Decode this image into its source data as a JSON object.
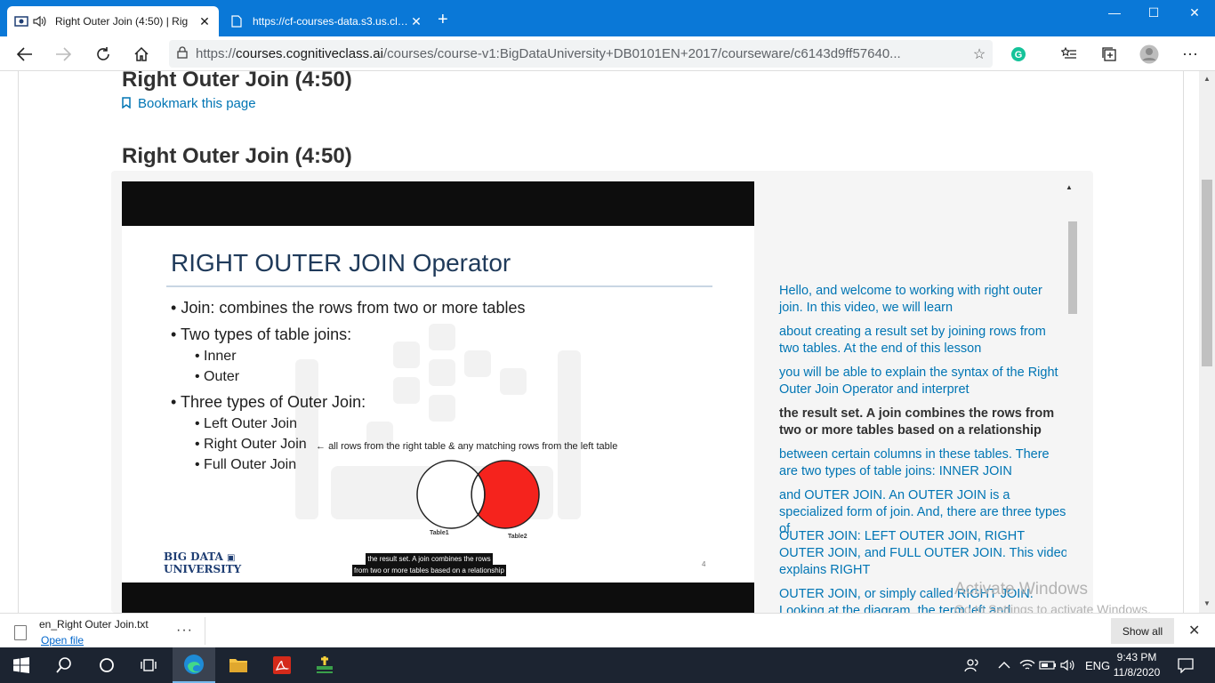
{
  "browser": {
    "tabs": [
      {
        "title": "Right Outer Join (4:50) | Rig",
        "active": true,
        "audio_icon": "speaker-icon"
      },
      {
        "title": "https://cf-courses-data.s3.us.clou",
        "active": false
      }
    ],
    "url_prefix": "https://",
    "url_host": "courses.cognitiveclass.ai",
    "url_path": "/courses/course-v1:BigDataUniversity+DB0101EN+2017/courseware/c6143d9ff57640..."
  },
  "page": {
    "heading1": "Right Outer Join (4:50)",
    "bookmark_label": "Bookmark this page",
    "heading2": "Right Outer Join (4:50)"
  },
  "slide": {
    "title": "RIGHT OUTER JOIN Operator",
    "bullets": {
      "b1": "Join: combines the rows from two or more tables",
      "b2": "Two types of table joins:",
      "b2a": "Inner",
      "b2b": "Outer",
      "b3": "Three types of Outer Join:",
      "b3a": "Left Outer Join",
      "b3b": "Right Outer Join",
      "b3c": "Full Outer Join"
    },
    "annotation": "all rows from the right table & any matching rows from the left table",
    "table1_label": "Table1",
    "table2_label": "Table2",
    "logo_line1": "BIG DATA",
    "logo_line2": "UNIVERSITY",
    "caption_line1": "the result set. A join combines the rows",
    "caption_line2": "from two or more tables based on a relationship",
    "page_number": "4",
    "highlight_color": "#f5231d"
  },
  "transcript": [
    "Hello, and welcome to working with right outer join. In this video, we will learn",
    "about creating a result set by joining rows from two tables. At the end of this lesson",
    "you will be able to explain the syntax of the Right Outer Join Operator and interpret",
    "the result set. A join combines the rows from two or more tables based on a relationship",
    "between certain columns in these tables. There are two types of table joins: INNER JOIN",
    "and OUTER JOIN. An OUTER JOIN is a specialized form of join. And, there are three types of",
    "OUTER JOIN: LEFT OUTER JOIN, RIGHT OUTER JOIN, and FULL OUTER JOIN. This video explains RIGHT",
    "OUTER JOIN, or simply called RIGHT JOIN.",
    "Looking at the diagram, the term left and"
  ],
  "watermark": {
    "line1": "Activate Windows",
    "line2": "Go to Settings to activate Windows."
  },
  "download": {
    "filename": "en_Right Outer Join.txt",
    "open_label": "Open file",
    "show_all_label": "Show all"
  },
  "taskbar": {
    "language": "ENG",
    "time": "9:43 PM",
    "date": "11/8/2020"
  }
}
